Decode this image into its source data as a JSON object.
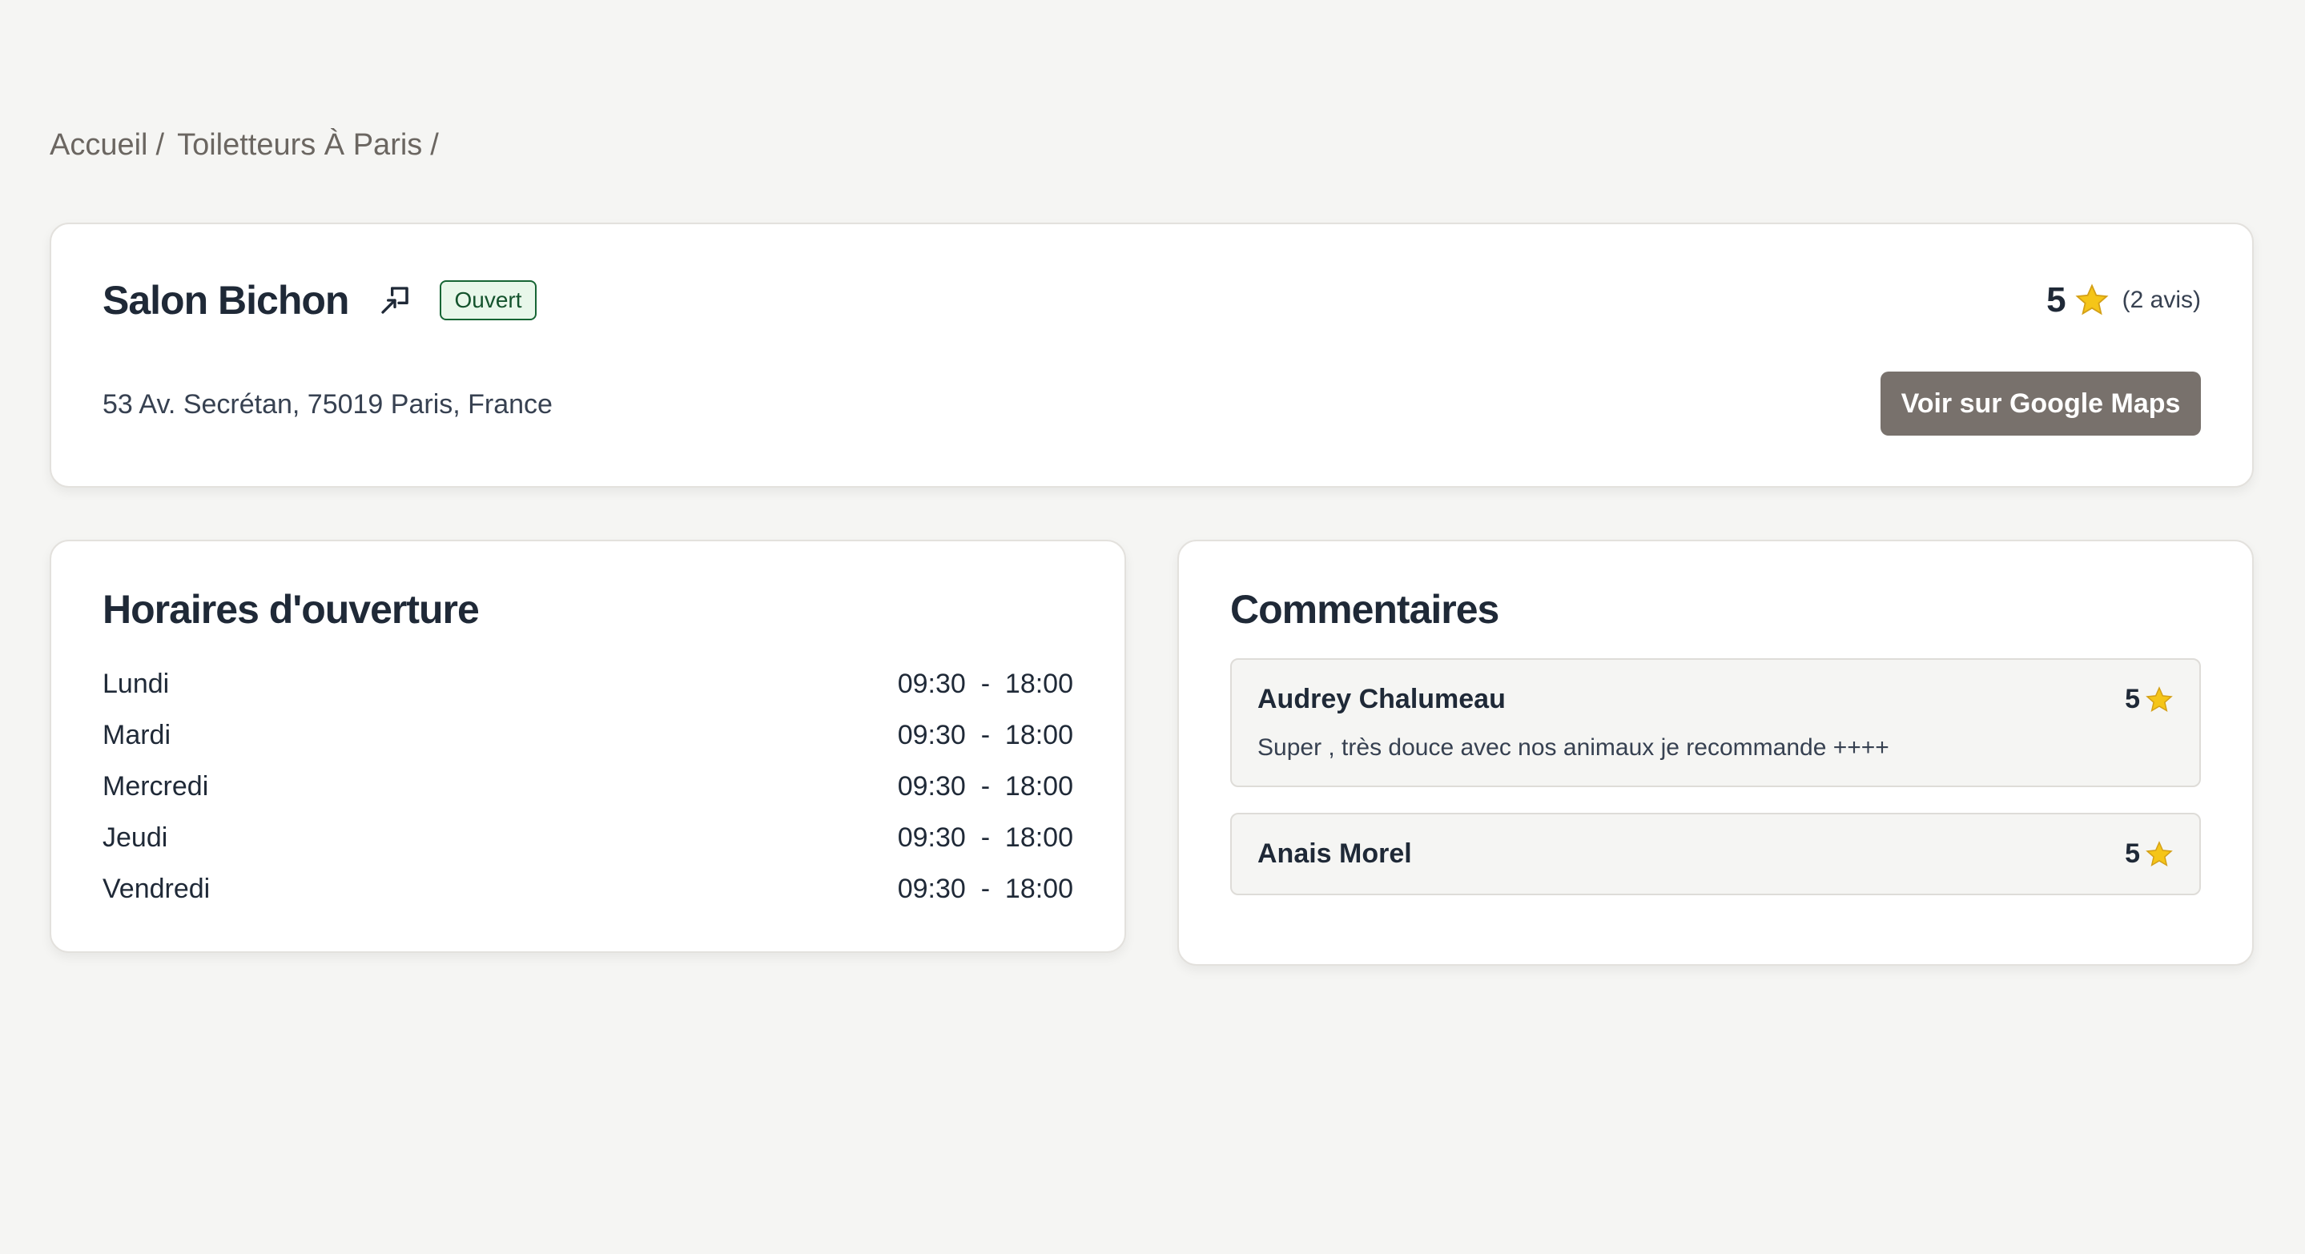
{
  "breadcrumb": {
    "items": [
      {
        "label": "Accueil",
        "sep": "/"
      },
      {
        "label": "Toiletteurs À Paris",
        "sep": "/"
      }
    ]
  },
  "salon": {
    "name": "Salon Bichon",
    "status": "Ouvert",
    "rating": "5",
    "reviews_count": "(2 avis)",
    "address": "53 Av. Secrétan, 75019 Paris, France",
    "maps_button": "Voir sur Google Maps",
    "share_icon": "external-link-icon",
    "star_icon": "star-icon"
  },
  "hours": {
    "title": "Horaires d'ouverture",
    "rows": [
      {
        "day": "Lundi",
        "time": "09:30  -  18:00"
      },
      {
        "day": "Mardi",
        "time": "09:30  -  18:00"
      },
      {
        "day": "Mercredi",
        "time": "09:30  -  18:00"
      },
      {
        "day": "Jeudi",
        "time": "09:30  -  18:00"
      },
      {
        "day": "Vendredi",
        "time": "09:30  -  18:00"
      }
    ]
  },
  "comments": {
    "title": "Commentaires",
    "items": [
      {
        "author": "Audrey Chalumeau",
        "rating": "5",
        "text": "Super , très douce avec nos animaux je recommande ++++"
      },
      {
        "author": "Anais Morel",
        "rating": "5",
        "text": ""
      }
    ]
  },
  "colors": {
    "background": "#f5f5f3",
    "button": "#78716c",
    "badge_border": "#166534",
    "badge_bg": "#e8f7ea",
    "star": "#f5c518"
  }
}
